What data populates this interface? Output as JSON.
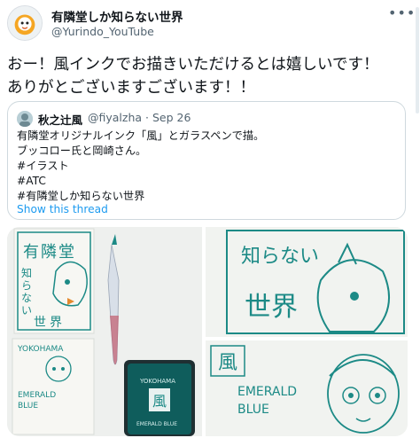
{
  "tweet": {
    "display_name": "有隣堂しか知らない世界",
    "handle": "@Yurindo_YouTube",
    "more_icon": "more-icon",
    "text_line1": "おー！風インクでお描きいただけるとは嬉しいです！",
    "text_line2": "ありがとございますございます！！"
  },
  "quote": {
    "display_name": "秋之辻風",
    "handle_time": "@fiyalzha · Sep 26",
    "lines": [
      "有隣堂オリジナルインク「風」とガラスペンで描。",
      "ブッコロー氏と岡崎さん。",
      "#イラスト",
      "#ATC",
      "#有隣堂しか知らない世界"
    ],
    "show_thread": "Show this thread"
  },
  "photos": {
    "photo1_sign": [
      "有",
      "隣",
      "堂"
    ],
    "photo1_sign2": [
      "知",
      "ら",
      "な",
      "い",
      "世",
      "界"
    ],
    "photo1_card_top": "YOKOHAMA",
    "photo1_card_text1": "EMERALD",
    "photo1_card_text2": "BLUE",
    "bottle_text1": "YOKOHAMA",
    "bottle_kanji": "風",
    "bottle_text2": "EMERALD BLUE",
    "photo2_text1": "知らない",
    "photo2_text2": "世界",
    "photo3_kanji": "風",
    "photo3_text1": "EMERALD",
    "photo3_text2": "BLUE"
  },
  "colors": {
    "ink": "#1c8a86",
    "link": "#1d9bf0",
    "muted": "#536471"
  }
}
